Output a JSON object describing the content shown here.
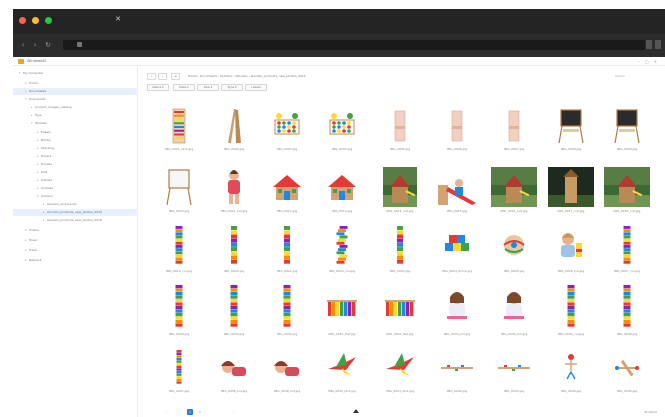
{
  "browser": {
    "tab_glyph": "✕",
    "traffic_colors": [
      "#ff5f56",
      "#ffbd2e",
      "#27c93f"
    ],
    "nav_back": "‹",
    "nav_forward": "›",
    "nav_reload": "↻"
  },
  "app": {
    "name": "WindowsIO",
    "controls": [
      "–",
      "□",
      "✕"
    ]
  },
  "sidebar": {
    "items": [
      {
        "label": "My Computer",
        "depth": 0,
        "expanded": true
      },
      {
        "label": "Home",
        "depth": 1
      },
      {
        "label": "Documents",
        "depth": 1,
        "selected": true
      },
      {
        "label": "Downloads",
        "depth": 1,
        "expanded": true
      },
      {
        "label": "product_images_catalog",
        "depth": 2
      },
      {
        "label": "Toys",
        "depth": 2
      },
      {
        "label": "Wooden",
        "depth": 2,
        "expanded": true
      },
      {
        "label": "Easels",
        "depth": 3
      },
      {
        "label": "Blocks",
        "depth": 3
      },
      {
        "label": "Stacking",
        "depth": 3
      },
      {
        "label": "Towers",
        "depth": 3
      },
      {
        "label": "Houses",
        "depth": 3
      },
      {
        "label": "Kids",
        "depth": 3
      },
      {
        "label": "Puzzles",
        "depth": 3
      },
      {
        "label": "Animals",
        "depth": 3
      },
      {
        "label": "Outdoor",
        "depth": 3,
        "expanded": true
      },
      {
        "label": "wooden_archive.zip",
        "depth": 4
      },
      {
        "label": "wooden_products_new_photos_2015",
        "depth": 4,
        "selected": true
      },
      {
        "label": "wooden_products_new_photos_2016",
        "depth": 4
      },
      {
        "label": "Videos",
        "depth": 1
      },
      {
        "label": "Music",
        "depth": 1
      },
      {
        "label": "Trash",
        "depth": 1
      },
      {
        "label": "Network",
        "depth": 1
      }
    ]
  },
  "toolbar": {
    "back": "‹",
    "forward": "›",
    "view": "≡",
    "path": "Home › Documents › Outdoor › Wooden › wooden_products_new_photos_2015",
    "search_placeholder": "Search"
  },
  "filters": [
    "Name ▾",
    "Date ▾",
    "Size ▾",
    "Type ▾",
    "Labels"
  ],
  "files": [
    {
      "name": "IMG_0001_rack.jpg",
      "thumb": "rack"
    },
    {
      "name": "IMG_0002.jpg",
      "thumb": "ladder"
    },
    {
      "name": "IMG_0003.jpg",
      "thumb": "abacus"
    },
    {
      "name": "IMG_0004.jpg",
      "thumb": "abacus"
    },
    {
      "name": "IMG_0005.jpg",
      "thumb": "slim-box"
    },
    {
      "name": "IMG_0006.jpg",
      "thumb": "slim-box"
    },
    {
      "name": "IMG_0007.jpg",
      "thumb": "slim-box"
    },
    {
      "name": "IMG_0008.jpg",
      "thumb": "chalkboard"
    },
    {
      "name": "IMG_0009.jpg",
      "thumb": "chalkboard"
    },
    {
      "name": "IMG_0010.jpg",
      "thumb": "easel"
    },
    {
      "name": "IMG_0011_kid.jpg",
      "thumb": "kid-stand"
    },
    {
      "name": "IMG_0012.jpg",
      "thumb": "house"
    },
    {
      "name": "IMG_0013.jpg",
      "thumb": "house"
    },
    {
      "name": "IMG_0014_out.jpg",
      "thumb": "outdoor"
    },
    {
      "name": "IMG_0015.jpg",
      "thumb": "slide-kid"
    },
    {
      "name": "IMG_0016_out.jpg",
      "thumb": "outdoor"
    },
    {
      "name": "IMG_0017_out.jpg",
      "thumb": "outdoor-dark"
    },
    {
      "name": "IMG_0018_out.jpg",
      "thumb": "outdoor"
    },
    {
      "name": "IMG_0019_col.jpg",
      "thumb": "tower"
    },
    {
      "name": "IMG_0020.jpg",
      "thumb": "tower-short"
    },
    {
      "name": "IMG_0021.jpg",
      "thumb": "tower-short"
    },
    {
      "name": "IMG_0022_col.jpg",
      "thumb": "tower-tilt"
    },
    {
      "name": "IMG_0023.jpg",
      "thumb": "tower-short"
    },
    {
      "name": "IMG_0024_block.jpg",
      "thumb": "blocks"
    },
    {
      "name": "IMG_0025.jpg",
      "thumb": "ball"
    },
    {
      "name": "IMG_0026_kid.jpg",
      "thumb": "kid-play"
    },
    {
      "name": "IMG_0027_col.jpg",
      "thumb": "tower"
    },
    {
      "name": "IMG_0028.jpg",
      "thumb": "tower"
    },
    {
      "name": "IMG_0029.jpg",
      "thumb": "tower"
    },
    {
      "name": "IMG_0030.jpg",
      "thumb": "tower"
    },
    {
      "name": "IMG_0031_flat.jpg",
      "thumb": "flat-stack"
    },
    {
      "name": "IMG_0032_flat.jpg",
      "thumb": "flat-stack"
    },
    {
      "name": "IMG_0033_kid.jpg",
      "thumb": "kid-sit"
    },
    {
      "name": "IMG_0034_kid.jpg",
      "thumb": "kid-sit"
    },
    {
      "name": "IMG_0035_col.jpg",
      "thumb": "tower"
    },
    {
      "name": "IMG_0036.jpg",
      "thumb": "tower"
    },
    {
      "name": "IMG_0037.jpg",
      "thumb": "tower-thin"
    },
    {
      "name": "IMG_0038_kid.jpg",
      "thumb": "kid-lay"
    },
    {
      "name": "IMG_0039_kid.jpg",
      "thumb": "kid-lay"
    },
    {
      "name": "IMG_0040_bird.jpg",
      "thumb": "bird"
    },
    {
      "name": "IMG_0041_bird.jpg",
      "thumb": "bird"
    },
    {
      "name": "IMG_0042.jpg",
      "thumb": "track"
    },
    {
      "name": "IMG_0043.jpg",
      "thumb": "track"
    },
    {
      "name": "IMG_0044.jpg",
      "thumb": "stick-figure"
    },
    {
      "name": "IMG_0045.jpg",
      "thumb": "plane"
    }
  ],
  "footer": {
    "pages": [
      "‹",
      "1",
      "2",
      "›"
    ],
    "status": "45 items"
  },
  "colors": {
    "selection": "#e7f0fb",
    "accent": "#2f7dd3",
    "chrome": "#242424"
  }
}
